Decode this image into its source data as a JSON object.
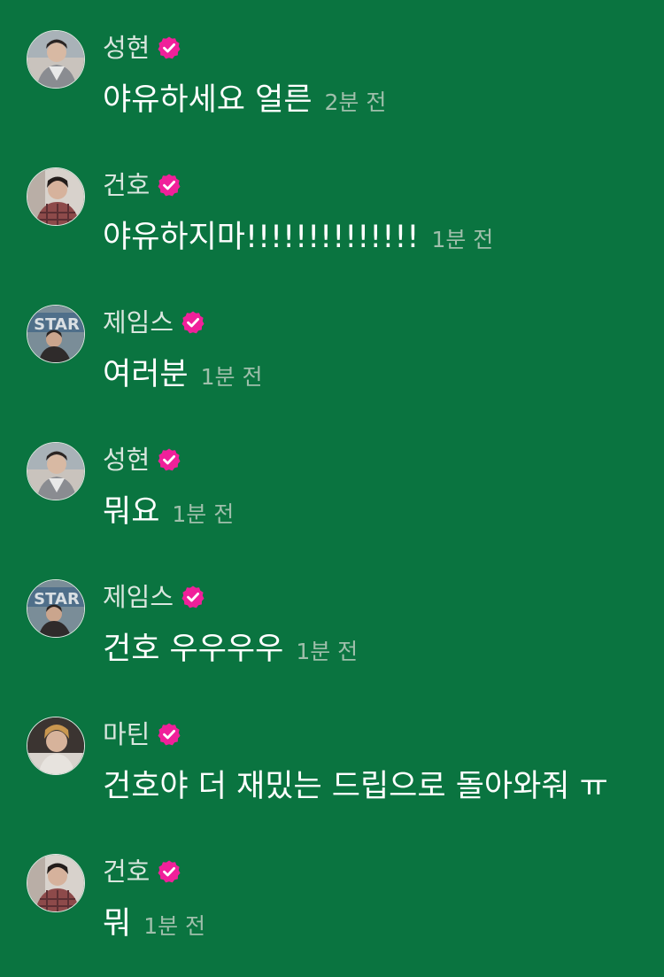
{
  "colors": {
    "background": "#0a7440",
    "name_text": "#d9e6de",
    "message_text": "#ffffff",
    "timestamp_text": "#9fbfab",
    "verified_badge": "#f0209a"
  },
  "comments": [
    {
      "author": "성현",
      "verified": true,
      "avatar_icon": "avatar-photo-icon",
      "text": "야유하세요 얼른",
      "time": "2분 전"
    },
    {
      "author": "건호",
      "verified": true,
      "avatar_icon": "avatar-photo-icon",
      "text": "야유하지마!!!!!!!!!!!!!!",
      "time": "1분 전"
    },
    {
      "author": "제임스",
      "verified": true,
      "avatar_icon": "avatar-photo-icon",
      "text": "여러분",
      "time": "1분 전"
    },
    {
      "author": "성현",
      "verified": true,
      "avatar_icon": "avatar-photo-icon",
      "text": "뭐요",
      "time": "1분 전"
    },
    {
      "author": "제임스",
      "verified": true,
      "avatar_icon": "avatar-photo-icon",
      "text": "건호 우우우우",
      "time": "1분 전"
    },
    {
      "author": "마틴",
      "verified": true,
      "avatar_icon": "avatar-photo-icon",
      "text": "건호야 더 재밌는 드립으로 돌아와줘 ㅠ",
      "time": ""
    },
    {
      "author": "건호",
      "verified": true,
      "avatar_icon": "avatar-photo-icon",
      "text": "뭐",
      "time": "1분 전"
    }
  ]
}
